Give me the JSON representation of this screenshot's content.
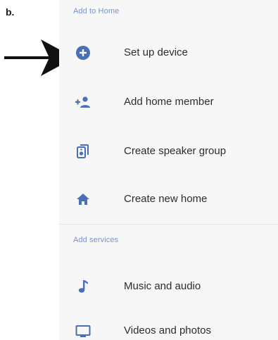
{
  "figure": {
    "label": "b."
  },
  "sections": {
    "add_to_home": {
      "header": "Add to Home",
      "items": [
        {
          "label": "Set up device",
          "icon": "add-circle-icon"
        },
        {
          "label": "Add home member",
          "icon": "add-person-icon"
        },
        {
          "label": "Create speaker group",
          "icon": "speaker-group-icon"
        },
        {
          "label": "Create new home",
          "icon": "home-icon"
        }
      ]
    },
    "add_services": {
      "header": "Add services",
      "items": [
        {
          "label": "Music and audio",
          "icon": "music-note-icon"
        },
        {
          "label": "Videos and photos",
          "icon": "tv-icon"
        }
      ]
    }
  },
  "colors": {
    "icon_blue": "#4a6fb5",
    "header_blue": "#7a93c9",
    "text": "#2c2c2c",
    "panel_bg": "#f7f7f7"
  }
}
